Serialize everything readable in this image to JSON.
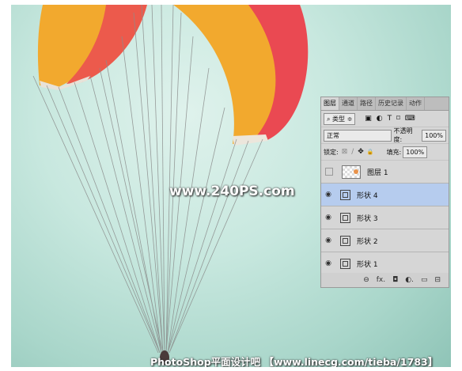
{
  "watermarks": {
    "center": "www.240PS.com",
    "bottom": "PhotoShop平面设计吧 【www.linecg.com/tieba/1783】"
  },
  "layers_panel": {
    "tabs": [
      "图层",
      "通道",
      "路径",
      "历史记录",
      "动作"
    ],
    "active_tab": "图层",
    "filter": {
      "search_icon": "⌕",
      "label": "类型",
      "arrow": "≑"
    },
    "filter_icons": [
      "▣",
      "◐",
      "T",
      "⌑",
      "⌨"
    ],
    "blend_mode": "正常",
    "opacity_label": "不透明度:",
    "opacity_value": "100%",
    "lock_label": "锁定:",
    "lock_icons": [
      "⊠",
      "∕",
      "✥",
      "🔒"
    ],
    "fill_label": "填充:",
    "fill_value": "100%",
    "layers": [
      {
        "name": "图层 1",
        "visible": false,
        "kind": "image",
        "selected": false
      },
      {
        "name": "形状 4",
        "visible": true,
        "kind": "shape",
        "selected": true
      },
      {
        "name": "形状 3",
        "visible": true,
        "kind": "shape",
        "selected": false
      },
      {
        "name": "形状 2",
        "visible": true,
        "kind": "shape",
        "selected": false
      },
      {
        "name": "形状 1",
        "visible": true,
        "kind": "shape",
        "selected": false
      }
    ],
    "bottom_icons": [
      "⊖",
      "fx.",
      "◘",
      "◐.",
      "▭",
      "⊟"
    ],
    "selected_color": "#b6ccee"
  },
  "colors": {
    "sky": "#bfe3d8",
    "glider_orange": "#f0a830",
    "glider_red": "#e8454e"
  }
}
